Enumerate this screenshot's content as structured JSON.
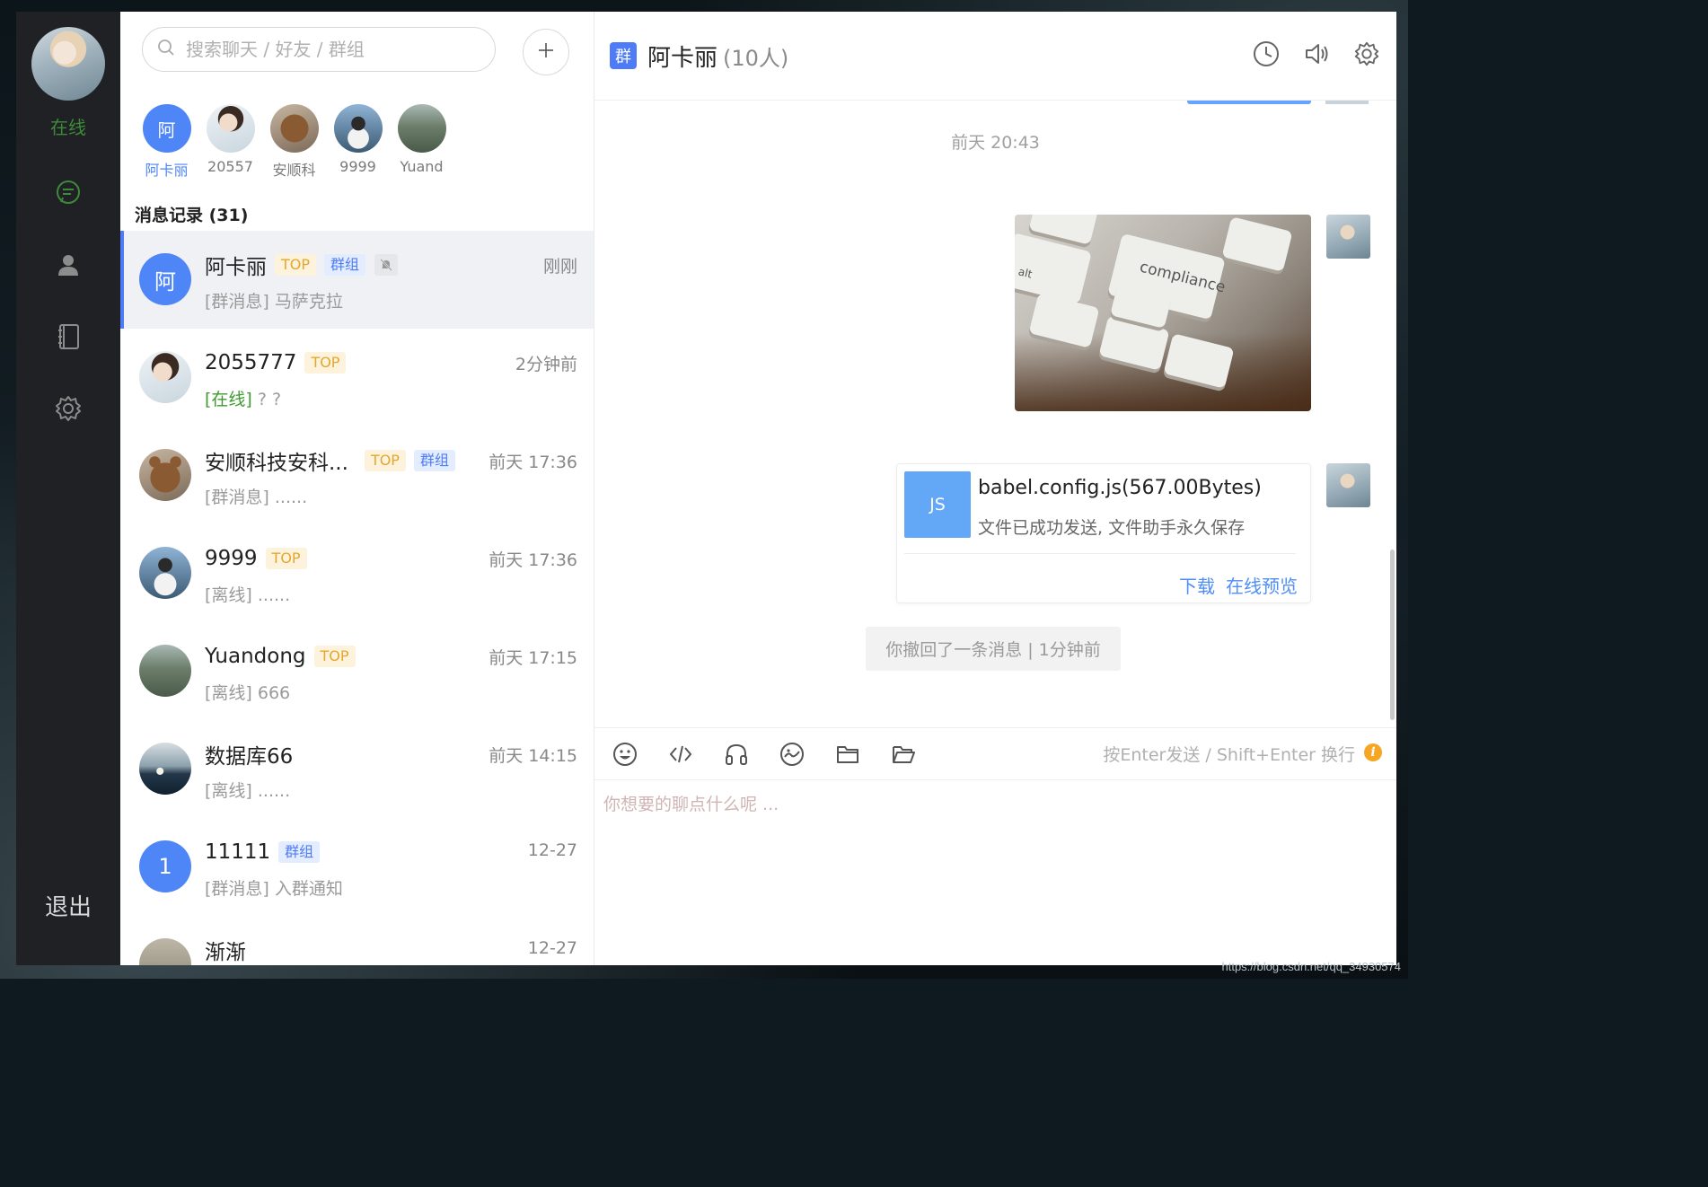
{
  "sidebar": {
    "status": "在线",
    "logout": "退出",
    "icons": [
      "chat-icon",
      "user-icon",
      "contacts-book-icon",
      "settings-gear-icon"
    ]
  },
  "search": {
    "placeholder": "搜索聊天 / 好友 / 群组"
  },
  "quick_contacts": [
    {
      "initial": "阿",
      "label": "阿卡丽"
    },
    {
      "label": "20557"
    },
    {
      "label": "安顺科"
    },
    {
      "label": "9999"
    },
    {
      "label": "Yuand"
    }
  ],
  "history": {
    "title": "消息记录 (31)"
  },
  "conversations": [
    {
      "initial": "阿",
      "name": "阿卡丽",
      "top": "TOP",
      "group": "群组",
      "muted": true,
      "time": "刚刚",
      "preview": "[群消息] 马萨克拉"
    },
    {
      "name": "2055777",
      "top": "TOP",
      "time": "2分钟前",
      "status": "[在线]",
      "preview": " ? ?"
    },
    {
      "name": "安顺科技安科...",
      "top": "TOP",
      "group": "群组",
      "time": "前天 17:36",
      "preview": "[群消息] ......"
    },
    {
      "name": "9999",
      "top": "TOP",
      "time": "前天 17:36",
      "preview": "[离线] ......"
    },
    {
      "name": "Yuandong",
      "top": "TOP",
      "time": "前天 17:15",
      "preview": "[离线] 666"
    },
    {
      "name": "数据库66",
      "time": "前天 14:15",
      "preview": "[离线] ......"
    },
    {
      "initial": "1",
      "name": "11111",
      "group": "群组",
      "time": "12-27",
      "preview": "[群消息] 入群通知"
    },
    {
      "name": "渐渐",
      "time": "12-27",
      "preview": ""
    }
  ],
  "chat": {
    "group_badge": "群",
    "title": "阿卡丽",
    "member_count": "(10人)",
    "timestamp": "前天 20:43",
    "image_keys": [
      "compliance",
      "alt"
    ],
    "file": {
      "type": "JS",
      "name": "babel.config.js(567.00Bytes)",
      "desc": "文件已成功发送, 文件助手永久保存",
      "download": "下载",
      "preview": "在线预览"
    },
    "recall": "你撤回了一条消息 | 1分钟前",
    "hint": "按Enter发送 / Shift+Enter 换行",
    "hint_icon": "i",
    "input_placeholder": "你想要的聊点什么呢 ..."
  },
  "watermark": "https://blog.csdn.net/qq_34930574",
  "colors": {
    "accent": "#4f7cf6",
    "online": "#3e9b2e",
    "tag_top": "#e3a72f",
    "link": "#4f8ef7"
  }
}
